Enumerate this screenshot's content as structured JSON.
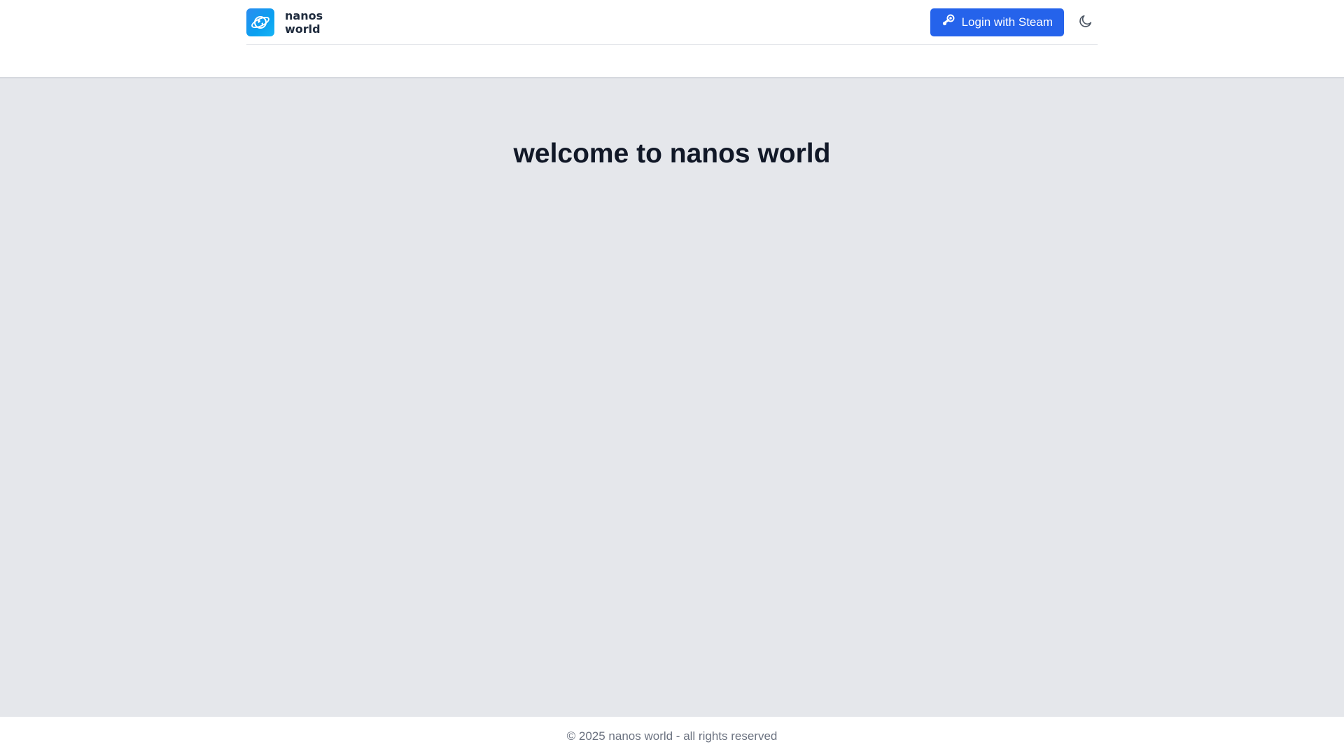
{
  "header": {
    "brand_line1": "nanos",
    "brand_line2": "world",
    "logo_icon": "planet-icon",
    "login_label": "Login with Steam",
    "login_icon": "steam-icon",
    "theme_icon": "moon-icon"
  },
  "main": {
    "title": "welcome to nanos world"
  },
  "footer": {
    "copyright": "© 2025 nanos world - all rights reserved"
  },
  "colors": {
    "accent": "#2563eb",
    "logo": "#0aa0f0",
    "background": "#e5e7eb",
    "text": "#111827",
    "muted": "#6b7280"
  }
}
